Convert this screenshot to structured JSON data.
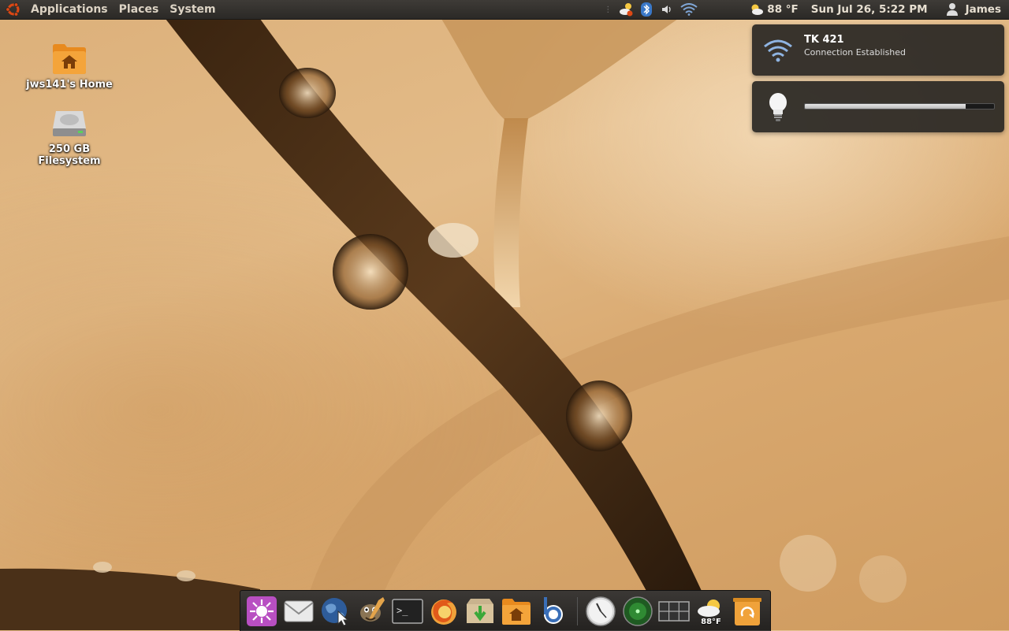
{
  "top_panel": {
    "menus": [
      "Applications",
      "Places",
      "System"
    ],
    "weather": "88 °F",
    "datetime": "Sun Jul 26,  5:22 PM",
    "user": "James"
  },
  "desktop": {
    "icons": [
      {
        "label": "jws141's Home",
        "icon": "home-folder-icon"
      },
      {
        "label": "250 GB Filesystem",
        "icon": "hard-drive-icon"
      }
    ]
  },
  "notifications": {
    "network": {
      "title": "TK 421",
      "body": "Connection Established",
      "icon": "wifi-icon"
    },
    "brightness": {
      "level": 0.85,
      "icon": "lightbulb-icon"
    }
  },
  "dock": {
    "items": [
      "gnome-do-icon",
      "mail-icon",
      "web-browser-icon",
      "gimp-icon",
      "terminal-icon",
      "firefox-icon",
      "archive-manager-icon",
      "home-folder-icon",
      "banshee-icon",
      "clock-icon",
      "radar-icon",
      "workspace-switcher-icon",
      "weather-icon",
      "trash-icon"
    ],
    "weather_temp": "88°F"
  },
  "colors": {
    "panel": "#2b2926",
    "wallpaper": "#dcb07a",
    "accent": "#dd4814"
  }
}
